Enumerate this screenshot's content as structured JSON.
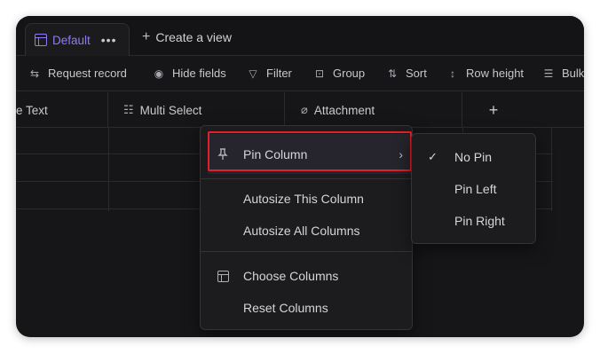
{
  "view_bar": {
    "active_view": "Default",
    "more_label": "•••",
    "create_view": "Create a view"
  },
  "toolbar": {
    "items": [
      {
        "label": "Request record",
        "icon": "swap-arrows-icon"
      },
      {
        "label": "Hide fields",
        "icon": "eye-icon"
      },
      {
        "label": "Filter",
        "icon": "filter-icon"
      },
      {
        "label": "Group",
        "icon": "group-icon"
      },
      {
        "label": "Sort",
        "icon": "sort-icon"
      },
      {
        "label": "Row height",
        "icon": "row-height-icon"
      },
      {
        "label": "Bulk",
        "icon": "bulk-icon"
      }
    ]
  },
  "grid": {
    "columns": [
      {
        "label": "e Text",
        "icon": ""
      },
      {
        "label": "Multi Select",
        "icon": "multi-select-icon"
      },
      {
        "label": "Attachment",
        "icon": "paperclip-icon"
      },
      {
        "label": "+",
        "icon": "add-column-icon"
      }
    ],
    "row_count": 3
  },
  "context_menu": {
    "pin_column": "Pin Column",
    "autosize_this": "Autosize This Column",
    "autosize_all": "Autosize All Columns",
    "choose_columns": "Choose Columns",
    "reset_columns": "Reset Columns"
  },
  "pin_submenu": {
    "options": [
      "No Pin",
      "Pin Left",
      "Pin Right"
    ],
    "selected": "No Pin"
  },
  "colors": {
    "accent": "#8b7cf6",
    "highlight_border": "#e0202a",
    "background": "#161618"
  }
}
